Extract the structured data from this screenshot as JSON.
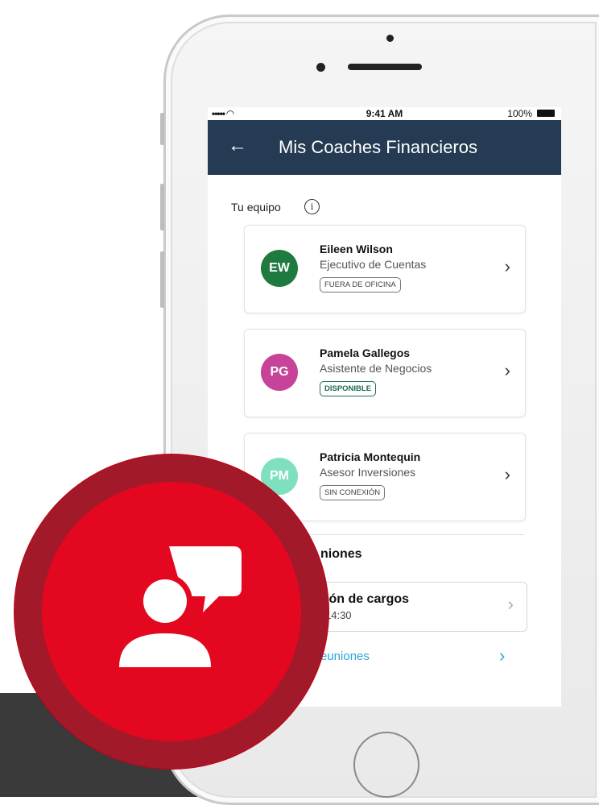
{
  "status_bar": {
    "signal": "••••• ὏6",
    "time": "9:41 AM",
    "battery": "100%"
  },
  "app_bar": {
    "back_icon": "arrow-left-icon",
    "title": "Mis Coaches Financieros"
  },
  "team": {
    "section_label": "Tu equipo",
    "info_icon": "info-icon",
    "coaches": [
      {
        "initials": "EW",
        "name": "Eileen Wilson",
        "role": "Ejecutivo de Cuentas",
        "status": "FUERA DE OFICINA",
        "avatar_color": "#1f7a3f"
      },
      {
        "initials": "PG",
        "name": "Pamela Gallegos",
        "role": "Asistente de Negocios",
        "status": "DISPONIBLE",
        "avatar_color": "#c7439a"
      },
      {
        "initials": "PM",
        "name": "Patricia Montequin",
        "role": "Asesor Inversiones",
        "status": "SIN CONEXIÓN",
        "avatar_color": "#7fe0bf"
      }
    ]
  },
  "meetings": {
    "title": "niones",
    "item_title": "ión de cargos",
    "item_time": "14:30",
    "all_link": "euniones"
  },
  "overlay": {
    "icon": "user-chat-icon",
    "color": "#e3081f"
  }
}
